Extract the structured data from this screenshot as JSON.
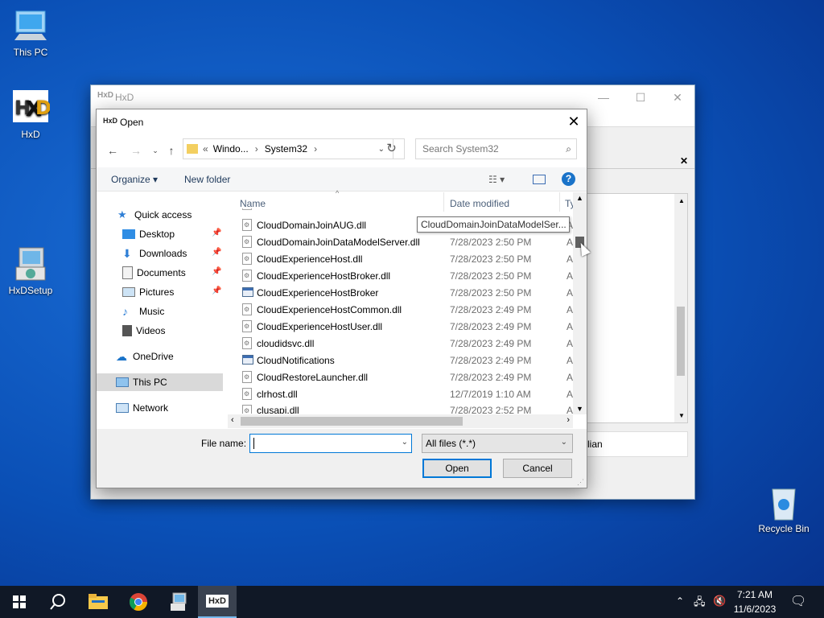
{
  "desktop": {
    "icons": [
      {
        "label": "This PC",
        "icon": "monitor-icon"
      },
      {
        "label": "HxD",
        "icon": "hxd-app-icon"
      },
      {
        "label": "HxDSetup",
        "icon": "installer-icon"
      },
      {
        "label": "Recycle Bin",
        "icon": "recycle-bin-icon"
      }
    ]
  },
  "hxd_window": {
    "title": "HxD",
    "right_panel_text": "lian"
  },
  "dialog": {
    "title": "Open",
    "address": {
      "overflow": "«",
      "crumbs": [
        "Windo...",
        "System32"
      ]
    },
    "search_placeholder": "Search System32",
    "commands": {
      "organize": "Organize ▾",
      "new_folder": "New folder"
    },
    "nav": [
      {
        "label": "Quick access",
        "icon": "star-icon"
      },
      {
        "label": "Desktop",
        "icon": "desktop-folder-icon",
        "pinned": true
      },
      {
        "label": "Downloads",
        "icon": "download-folder-icon",
        "pinned": true
      },
      {
        "label": "Documents",
        "icon": "documents-folder-icon",
        "pinned": true
      },
      {
        "label": "Pictures",
        "icon": "pictures-folder-icon",
        "pinned": true
      },
      {
        "label": "Music",
        "icon": "music-folder-icon"
      },
      {
        "label": "Videos",
        "icon": "videos-folder-icon"
      },
      {
        "label": "OneDrive",
        "icon": "cloud-icon"
      },
      {
        "label": "This PC",
        "icon": "monitor-icon",
        "selected": true
      },
      {
        "label": "Network",
        "icon": "network-icon"
      }
    ],
    "columns": {
      "name": "Name",
      "date": "Date modified",
      "type": "Ty"
    },
    "files": [
      {
        "name": "CloudDomainJoinAUG.dll",
        "date": "",
        "type": "A|",
        "kind": "dll"
      },
      {
        "name": "CloudDomainJoinDataModelServer.dll",
        "date": "7/28/2023 2:50 PM",
        "type": "A|",
        "kind": "dll"
      },
      {
        "name": "CloudExperienceHost.dll",
        "date": "7/28/2023 2:50 PM",
        "type": "A|",
        "kind": "dll"
      },
      {
        "name": "CloudExperienceHostBroker.dll",
        "date": "7/28/2023 2:50 PM",
        "type": "A|",
        "kind": "dll"
      },
      {
        "name": "CloudExperienceHostBroker",
        "date": "7/28/2023 2:50 PM",
        "type": "A|",
        "kind": "app"
      },
      {
        "name": "CloudExperienceHostCommon.dll",
        "date": "7/28/2023 2:49 PM",
        "type": "A|",
        "kind": "dll"
      },
      {
        "name": "CloudExperienceHostUser.dll",
        "date": "7/28/2023 2:49 PM",
        "type": "A|",
        "kind": "dll"
      },
      {
        "name": "cloudidsvc.dll",
        "date": "7/28/2023 2:49 PM",
        "type": "A|",
        "kind": "dll"
      },
      {
        "name": "CloudNotifications",
        "date": "7/28/2023 2:49 PM",
        "type": "A|",
        "kind": "app"
      },
      {
        "name": "CloudRestoreLauncher.dll",
        "date": "7/28/2023 2:49 PM",
        "type": "A|",
        "kind": "dll"
      },
      {
        "name": "clrhost.dll",
        "date": "12/7/2019 1:10 AM",
        "type": "A|",
        "kind": "dll"
      },
      {
        "name": "clusapi.dll",
        "date": "7/28/2023 2:52 PM",
        "type": "A|",
        "kind": "dll"
      }
    ],
    "tooltip": "CloudDomainJoinDataModelSer...",
    "file_name_label": "File name:",
    "file_name_value": "",
    "file_type": "All files (*.*)",
    "open_label": "Open",
    "cancel_label": "Cancel"
  },
  "taskbar": {
    "apps": [
      "windows-start-icon",
      "search-icon",
      "file-explorer-icon",
      "chrome-icon",
      "installer-icon",
      "hxd-app-icon"
    ],
    "time": "7:21 AM",
    "date": "11/6/2023"
  },
  "colors": {
    "accent": "#0078d7",
    "taskbar": "#101826"
  }
}
